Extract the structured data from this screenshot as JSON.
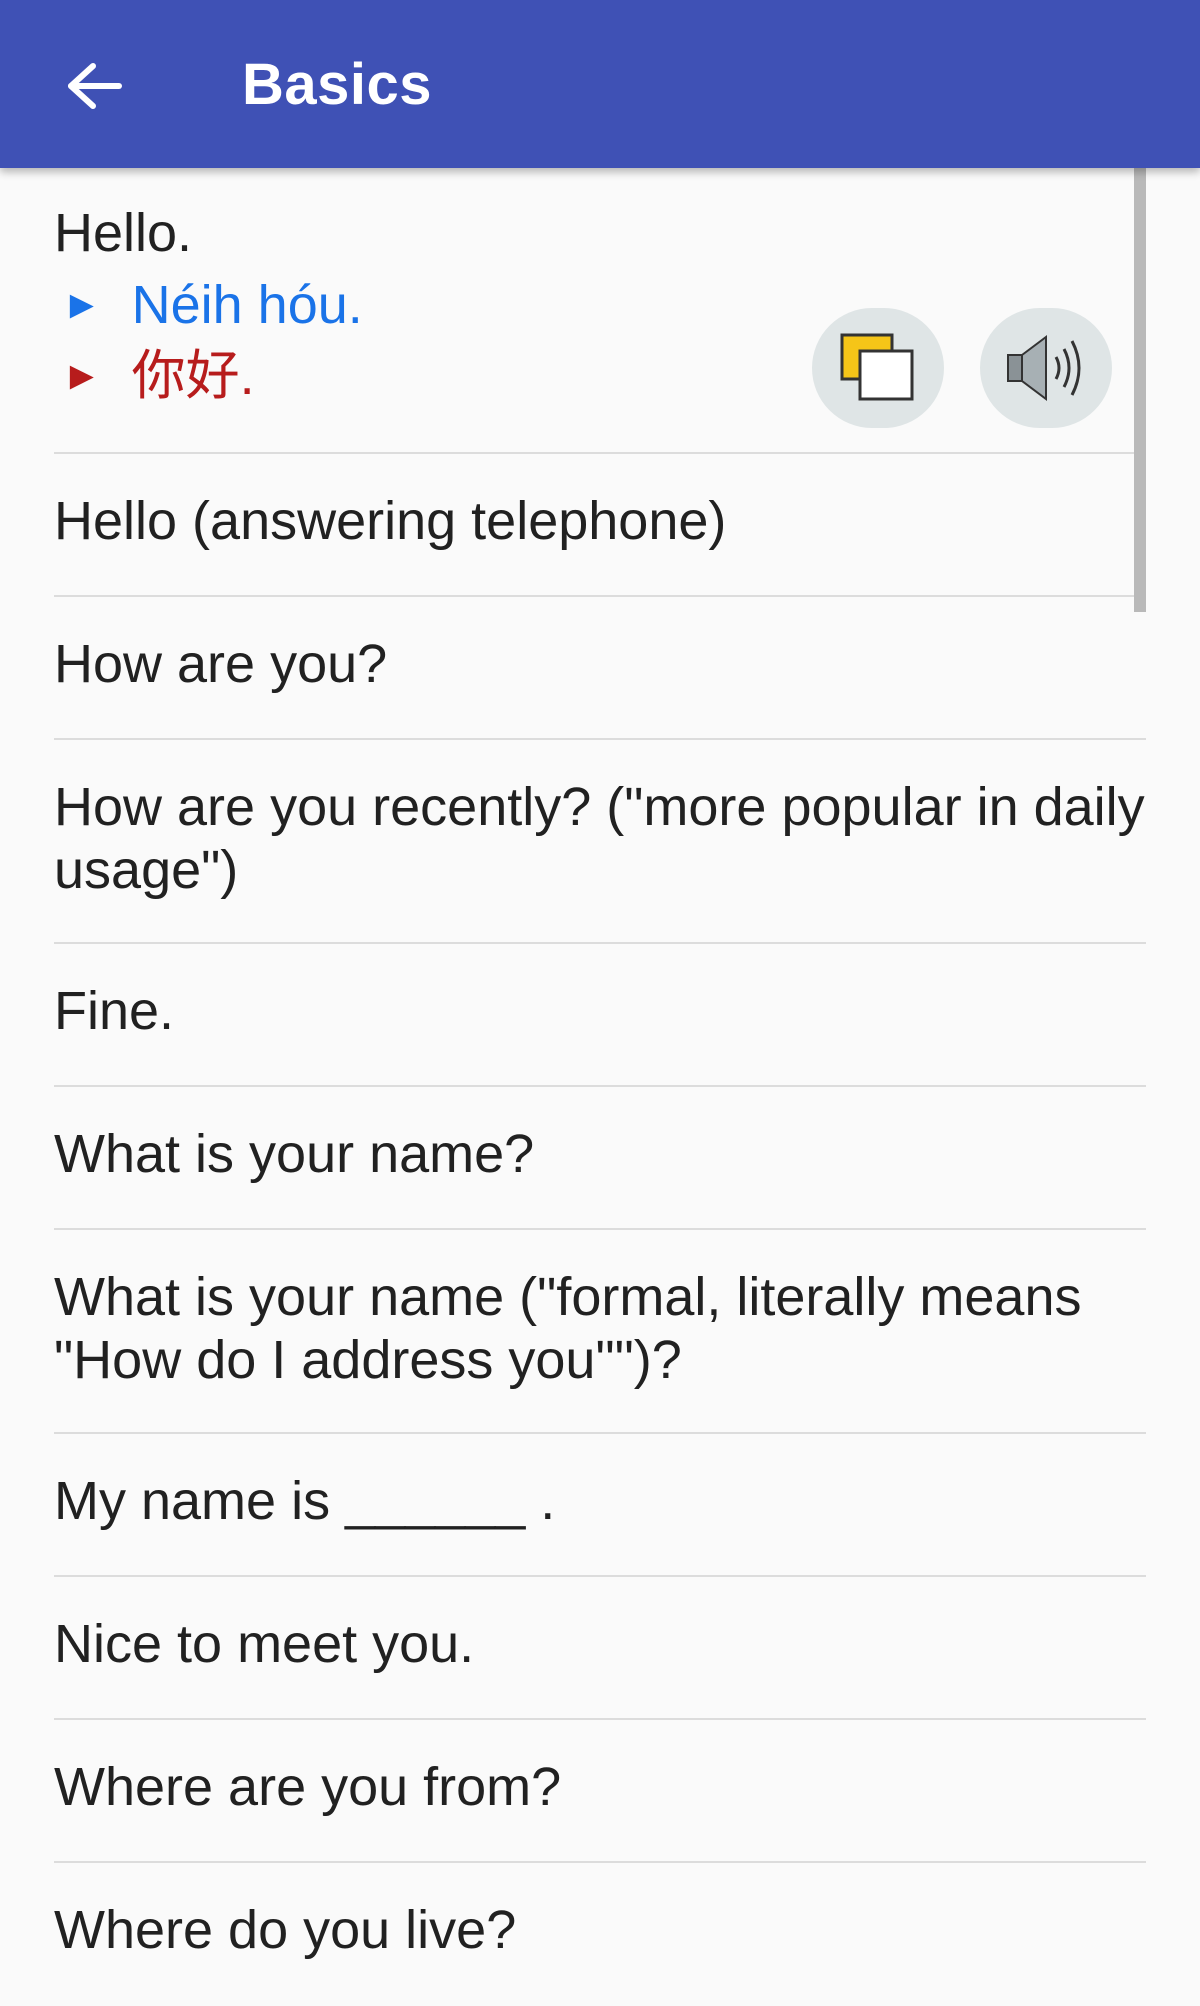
{
  "appbar": {
    "title": "Basics",
    "back_icon": "arrow-left-icon",
    "background": "#3f51b5"
  },
  "expanded_item": {
    "english": "Hello.",
    "romanization": "Néih hóu.",
    "chinese": "你好.",
    "romanization_color": "#1a73e8",
    "chinese_color": "#b71c1c",
    "actions": [
      {
        "name": "copy",
        "icon": "copy-icon"
      },
      {
        "name": "play",
        "icon": "speaker-icon"
      }
    ]
  },
  "phrases": [
    "Hello (answering telephone)",
    "How are you?",
    "How are you recently? (\"more popular in daily usage\")",
    "Fine.",
    "What is your name?",
    "What is your name (\"formal, literally means \"How do I address you\"\")?",
    "My name is ______ .",
    "Nice to meet you.",
    "Where are you from?",
    "Where do you live?"
  ]
}
